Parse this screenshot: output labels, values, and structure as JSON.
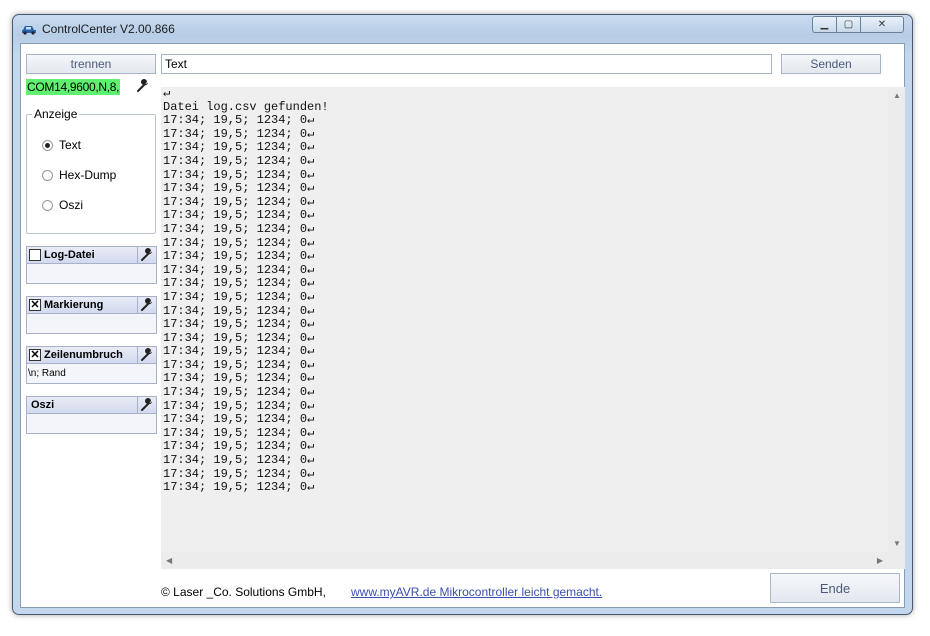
{
  "window": {
    "title": "ControlCenter V2.00.866"
  },
  "toolbar": {
    "disconnect_label": "trennen",
    "send_input_value": "Text",
    "send_label": "Senden"
  },
  "port": {
    "settings": "COM14,9600,N,8,"
  },
  "anzeige": {
    "legend": "Anzeige",
    "options": [
      "Text",
      "Hex-Dump",
      "Oszi"
    ],
    "selected": "Text"
  },
  "panels": {
    "log": {
      "label": "Log-Datei",
      "checked": false,
      "detail": ""
    },
    "markierung": {
      "label": "Markierung",
      "checked": true,
      "detail": ""
    },
    "zeilenumbruch": {
      "label": "Zeilenumbruch",
      "checked": true,
      "detail": "\\n; Rand"
    },
    "oszi": {
      "label": "Oszi",
      "detail": ""
    }
  },
  "output": {
    "lines": [
      "↵",
      "Datei log.csv gefunden!",
      "17:34; 19,5; 1234; 0↵",
      "17:34; 19,5; 1234; 0↵",
      "17:34; 19,5; 1234; 0↵",
      "17:34; 19,5; 1234; 0↵",
      "17:34; 19,5; 1234; 0↵",
      "17:34; 19,5; 1234; 0↵",
      "17:34; 19,5; 1234; 0↵",
      "17:34; 19,5; 1234; 0↵",
      "17:34; 19,5; 1234; 0↵",
      "17:34; 19,5; 1234; 0↵",
      "17:34; 19,5; 1234; 0↵",
      "17:34; 19,5; 1234; 0↵",
      "17:34; 19,5; 1234; 0↵",
      "17:34; 19,5; 1234; 0↵",
      "17:34; 19,5; 1234; 0↵",
      "17:34; 19,5; 1234; 0↵",
      "17:34; 19,5; 1234; 0↵",
      "17:34; 19,5; 1234; 0↵",
      "17:34; 19,5; 1234; 0↵",
      "17:34; 19,5; 1234; 0↵",
      "17:34; 19,5; 1234; 0↵",
      "17:34; 19,5; 1234; 0↵",
      "17:34; 19,5; 1234; 0↵",
      "17:34; 19,5; 1234; 0↵",
      "17:34; 19,5; 1234; 0↵",
      "17:34; 19,5; 1234; 0↵",
      "17:34; 19,5; 1234; 0↵",
      "17:34; 19,5; 1234; 0↵"
    ]
  },
  "footer": {
    "copyright": "© Laser _Co. Solutions GmbH,",
    "link": "www.myAVR.de Mikrocontroller leicht gemacht.",
    "end_label": "Ende"
  },
  "colors": {
    "port_badge": "#5ef06e",
    "output_bg": "#efefef",
    "window_frame": "#c3d7ed"
  },
  "icons": {
    "app": "car-icon",
    "wrench": "wrench-icon"
  }
}
